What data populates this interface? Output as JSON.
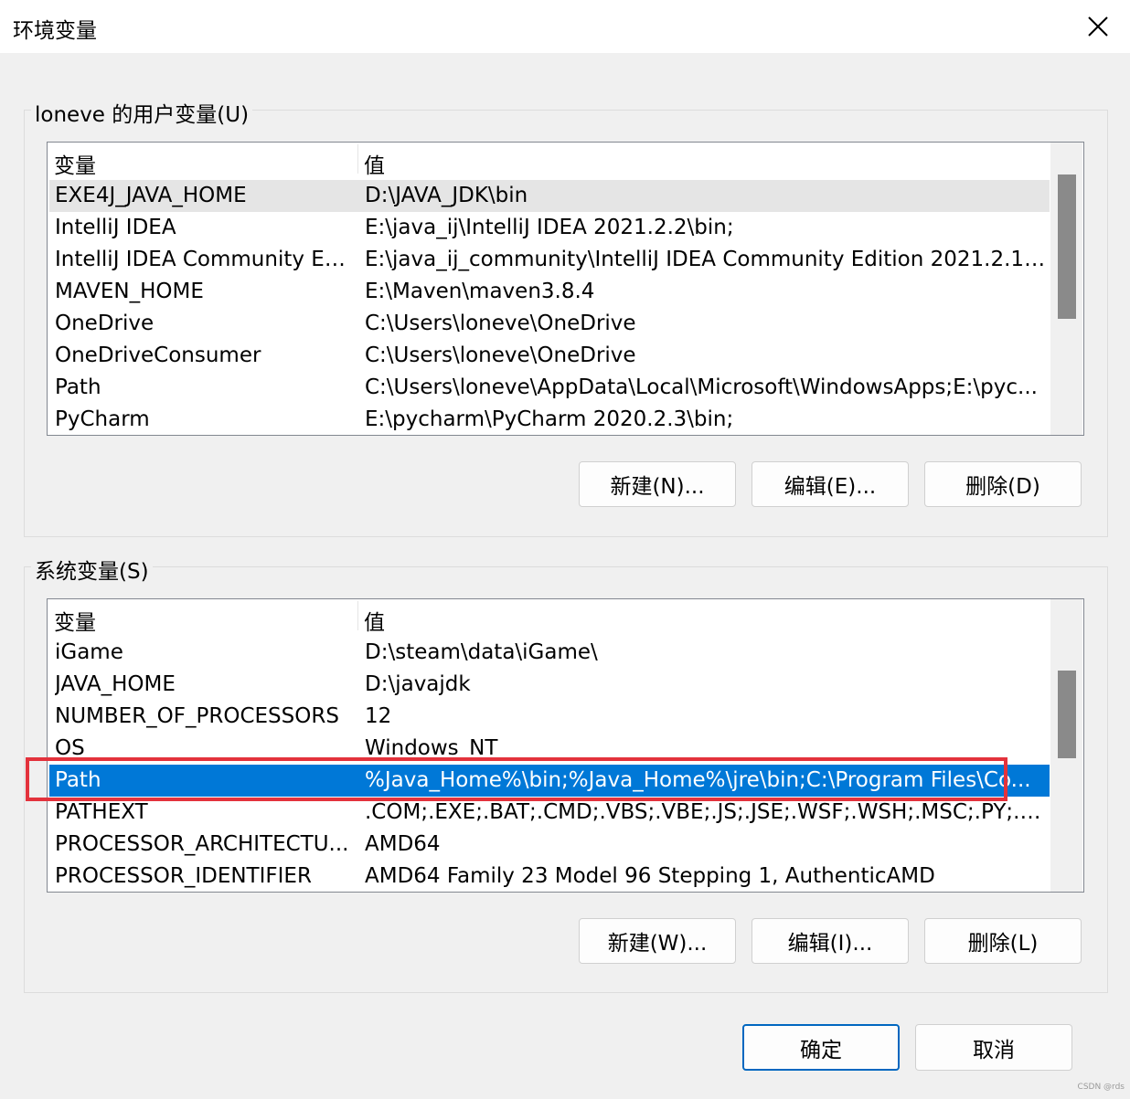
{
  "window": {
    "title": "环境变量",
    "close_icon": "close-icon"
  },
  "user_vars": {
    "legend": "loneve 的用户变量(U)",
    "columns": {
      "name": "变量",
      "value": "值"
    },
    "rows": [
      {
        "name": "EXE4J_JAVA_HOME",
        "value": "D:\\JAVA_JDK\\bin"
      },
      {
        "name": "IntelliJ IDEA",
        "value": "E:\\java_ij\\IntelliJ IDEA 2021.2.2\\bin;"
      },
      {
        "name": "IntelliJ IDEA Community Ed...",
        "value": "E:\\java_ij_community\\IntelliJ IDEA Community Edition 2021.2.1\\..."
      },
      {
        "name": "MAVEN_HOME",
        "value": "E:\\Maven\\maven3.8.4"
      },
      {
        "name": "OneDrive",
        "value": "C:\\Users\\loneve\\OneDrive"
      },
      {
        "name": "OneDriveConsumer",
        "value": "C:\\Users\\loneve\\OneDrive"
      },
      {
        "name": "Path",
        "value": "C:\\Users\\loneve\\AppData\\Local\\Microsoft\\WindowsApps;E:\\pyc..."
      },
      {
        "name": "PyCharm",
        "value": "E:\\pycharm\\PyCharm 2020.2.3\\bin;"
      }
    ],
    "buttons": {
      "new": "新建(N)...",
      "edit": "编辑(E)...",
      "delete": "删除(D)"
    }
  },
  "system_vars": {
    "legend": "系统变量(S)",
    "columns": {
      "name": "变量",
      "value": "值"
    },
    "rows": [
      {
        "name": "iGame",
        "value": "D:\\steam\\data\\iGame\\"
      },
      {
        "name": "JAVA_HOME",
        "value": "D:\\javajdk"
      },
      {
        "name": "NUMBER_OF_PROCESSORS",
        "value": "12"
      },
      {
        "name": "OS",
        "value": "Windows_NT"
      },
      {
        "name": "Path",
        "value": "%Java_Home%\\bin;%Java_Home%\\jre\\bin;C:\\Program Files\\Co..."
      },
      {
        "name": "PATHEXT",
        "value": ".COM;.EXE;.BAT;.CMD;.VBS;.VBE;.JS;.JSE;.WSF;.WSH;.MSC;.PY;.PY..."
      },
      {
        "name": "PROCESSOR_ARCHITECTU...",
        "value": "AMD64"
      },
      {
        "name": "PROCESSOR_IDENTIFIER",
        "value": "AMD64 Family 23 Model 96 Stepping 1, AuthenticAMD"
      }
    ],
    "selected_row": "Path",
    "buttons": {
      "new": "新建(W)...",
      "edit": "编辑(I)...",
      "delete": "删除(L)"
    }
  },
  "footer": {
    "ok": "确定",
    "cancel": "取消"
  },
  "watermark": "CSDN @rds",
  "colors": {
    "selection": "#0078d7",
    "highlight_box": "#e3323c",
    "primary_border": "#0067c0"
  }
}
